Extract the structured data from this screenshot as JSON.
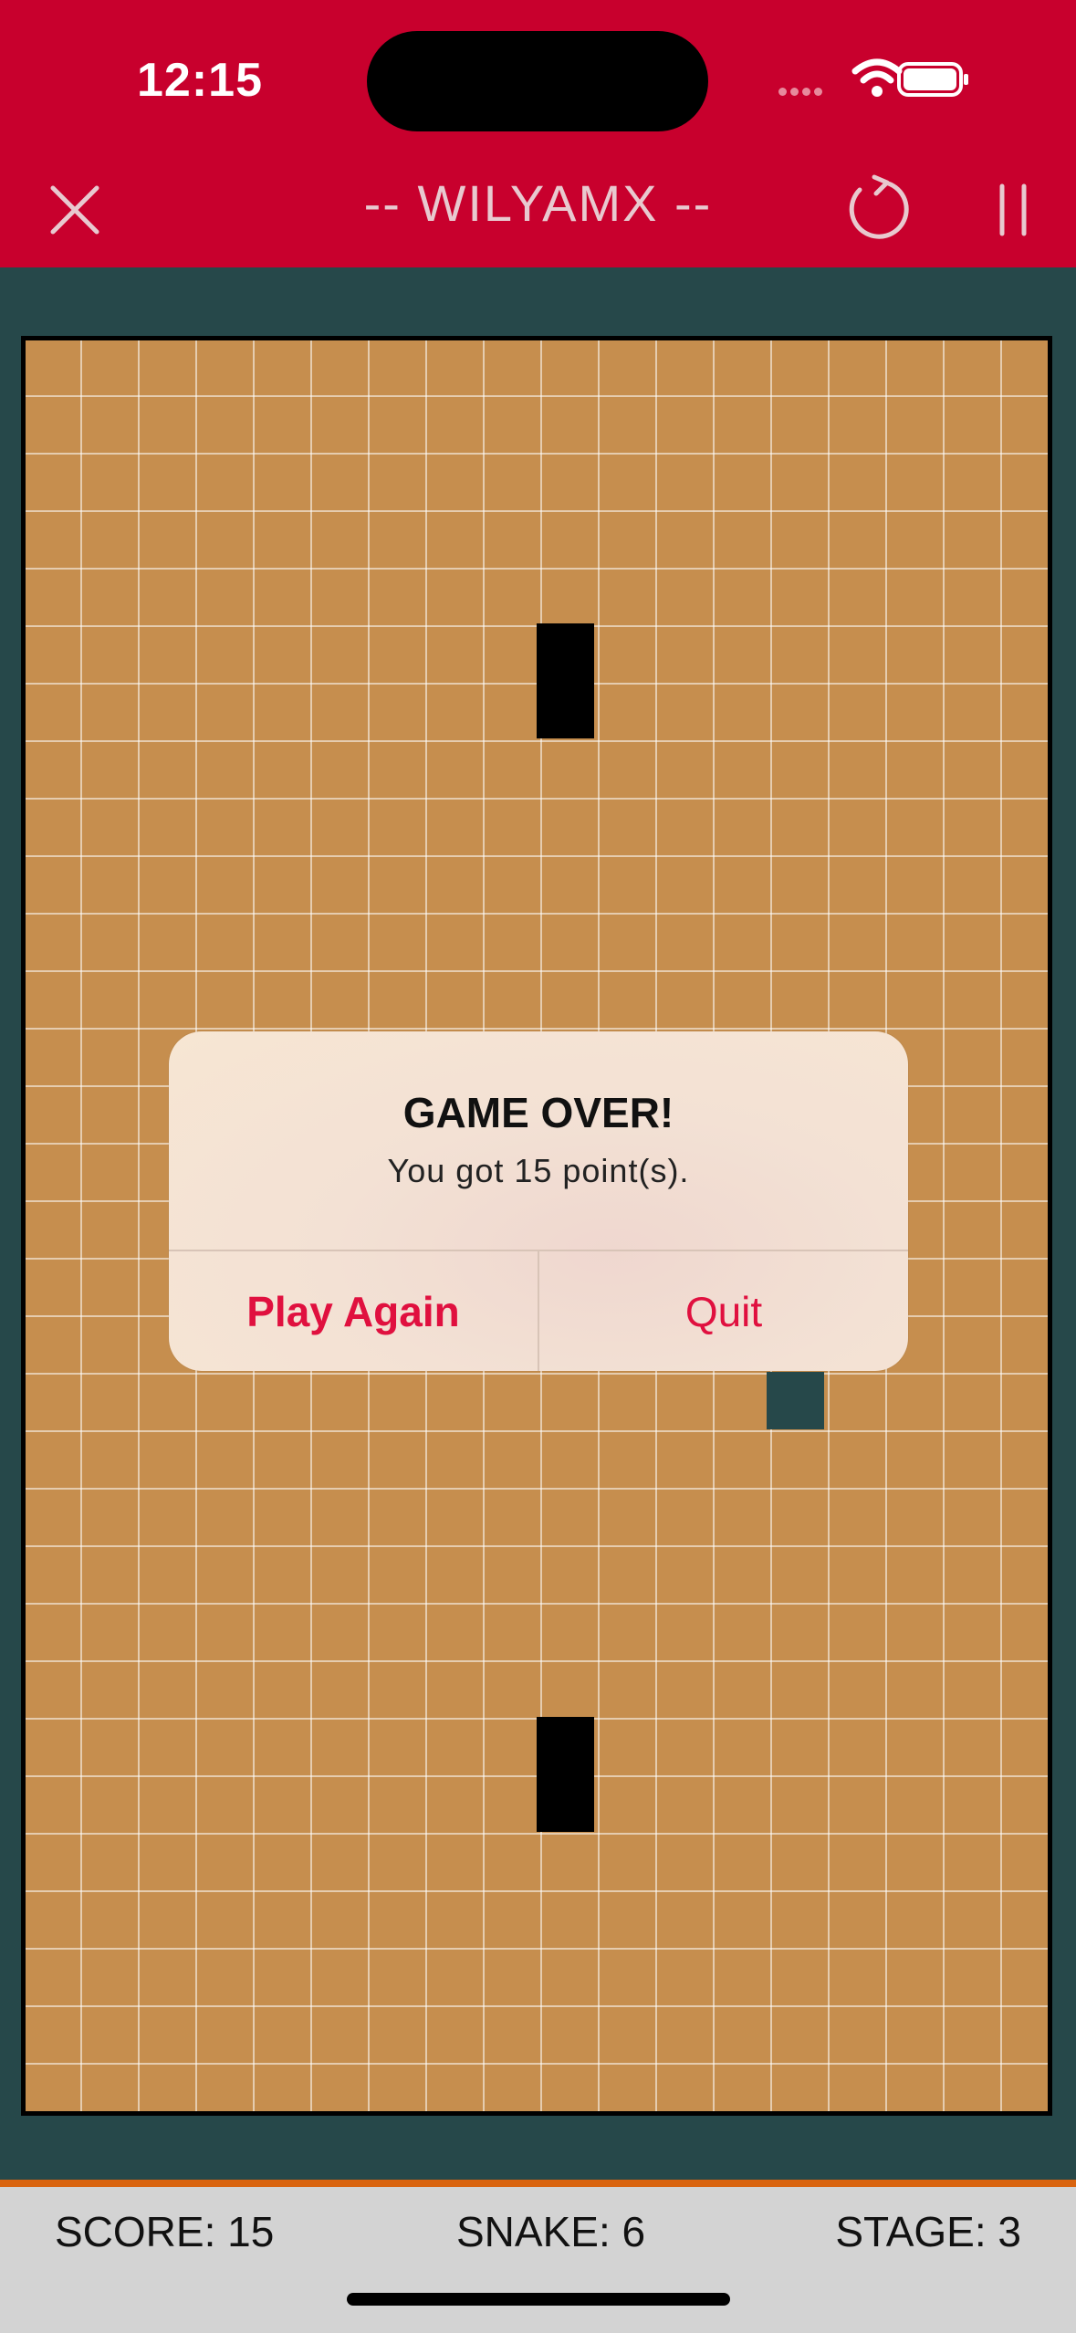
{
  "status_bar": {
    "time": "12:15"
  },
  "header": {
    "title": "-- WILYAMX --",
    "icons": {
      "close": "close-icon",
      "restart": "restart-icon",
      "pause": "pause-icon"
    },
    "bg_color": "#c8002d"
  },
  "board": {
    "bg_color": "#c68e4e",
    "walls": "black",
    "snake_color": "#26484a"
  },
  "dialog": {
    "title": "GAME OVER!",
    "message": "You got 15 point(s).",
    "play_again_label": "Play Again",
    "quit_label": "Quit",
    "button_color": "#e0103f"
  },
  "footer": {
    "score": "SCORE: 15",
    "snake": "SNAKE: 6",
    "stage": "STAGE: 3"
  }
}
